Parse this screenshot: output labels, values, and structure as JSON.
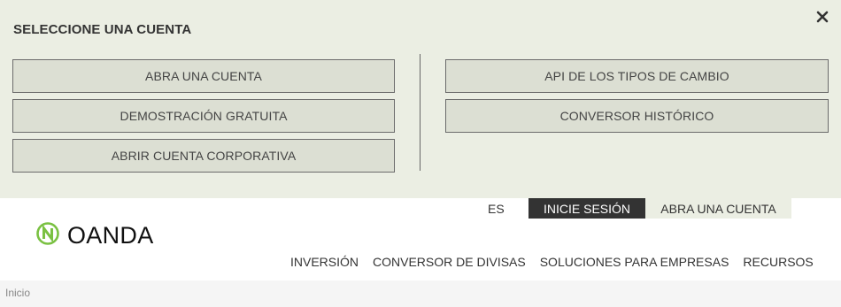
{
  "account_panel": {
    "title": "SELECCIONE UNA CUENTA",
    "close_icon": "close-icon",
    "left_buttons": [
      "ABRA UNA CUENTA",
      "DEMOSTRACIÓN GRATUITA",
      "ABRIR CUENTA CORPORATIVA"
    ],
    "right_buttons": [
      "API DE LOS TIPOS DE CAMBIO",
      "CONVERSOR HISTÓRICO"
    ]
  },
  "header": {
    "logo_text": "OANDA",
    "logo_icon": "oanda-logo-icon",
    "brand_color": "#7ac142",
    "lang": "ES",
    "login_label": "INICIE SESIÓN",
    "open_account_label": "ABRA UNA CUENTA",
    "nav": [
      "INVERSIÓN",
      "CONVERSOR DE DIVISAS",
      "SOLUCIONES PARA EMPRESAS",
      "RECURSOS"
    ]
  },
  "breadcrumb": {
    "current": "Inicio"
  }
}
